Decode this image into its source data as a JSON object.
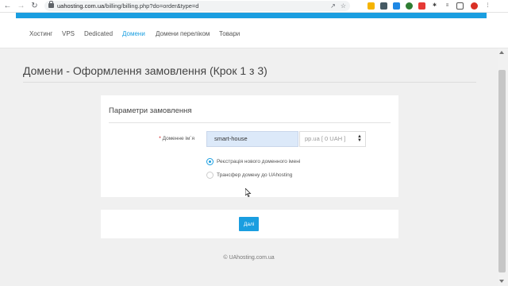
{
  "browser": {
    "url_host": "uahosting.com.ua",
    "url_path": "/billing/billing.php?do=order&type=d",
    "icons": [
      "back-icon",
      "forward-icon",
      "reload-icon",
      "share-icon",
      "star-icon"
    ]
  },
  "nav": {
    "items": [
      "Хостинг",
      "VPS",
      "Dedicated",
      "Домени",
      "Домени перелiком",
      "Товари"
    ],
    "active_index": 3
  },
  "page": {
    "title": "Домени - Оформлення замовлення (Крок 1 з 3)"
  },
  "order": {
    "section_title": "Параметри замовлення",
    "required_mark": "*",
    "domain_label": "Доменне ім`я",
    "domain_value": "smart-house",
    "tld_value": "pp.ua [ 0 UAH ]",
    "options": [
      {
        "label": "Реєстрація нового доменного імені",
        "checked": true
      },
      {
        "label": "Трансфер домену до UAhosting",
        "checked": false
      }
    ],
    "next_label": "Далі"
  },
  "footer": {
    "text": "© UAhosting.com.ua"
  },
  "colors": {
    "accent": "#1a9ee0",
    "input_bg": "#dce9f9"
  }
}
